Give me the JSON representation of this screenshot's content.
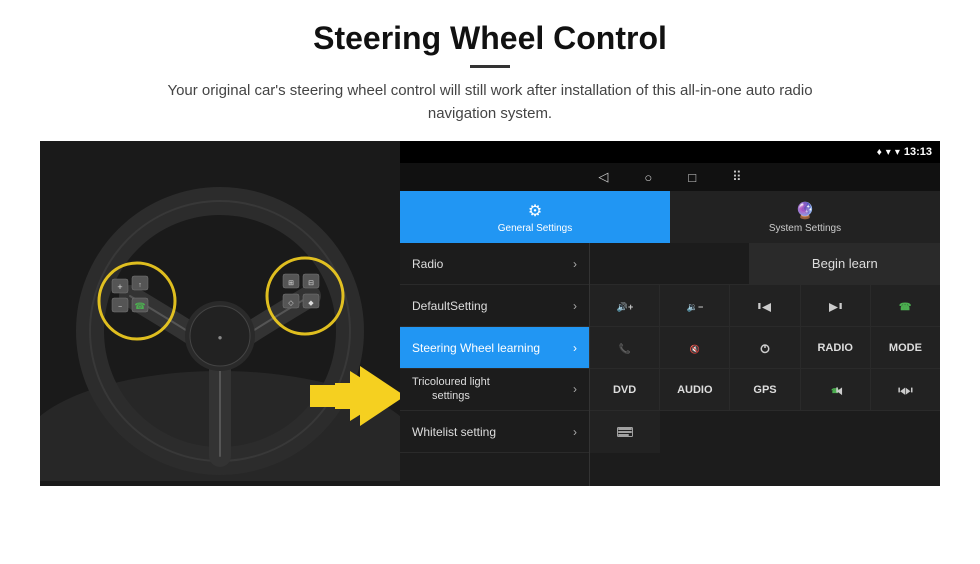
{
  "header": {
    "title": "Steering Wheel Control",
    "divider": true,
    "subtitle": "Your original car's steering wheel control will still work after installation of this all-in-one auto radio navigation system."
  },
  "status_bar": {
    "location_icon": "♦",
    "wifi_icon": "▾",
    "signal_icon": "▾",
    "time": "13:13"
  },
  "nav_bar": {
    "back": "◁",
    "home": "○",
    "recent": "□",
    "menu": "⠿"
  },
  "tabs": [
    {
      "id": "general",
      "label": "General Settings",
      "active": true
    },
    {
      "id": "system",
      "label": "System Settings",
      "active": false
    }
  ],
  "menu_items": [
    {
      "id": "radio",
      "label": "Radio",
      "active": false
    },
    {
      "id": "default",
      "label": "DefaultSetting",
      "active": false
    },
    {
      "id": "steering",
      "label": "Steering Wheel learning",
      "active": true
    },
    {
      "id": "tricoloured",
      "label": "Tricoloured light settings",
      "active": false
    },
    {
      "id": "whitelist",
      "label": "Whitelist setting",
      "active": false
    }
  ],
  "controls": {
    "begin_learn": "Begin learn",
    "row1": [
      "vol+",
      "vol-",
      "prev-track",
      "next-track",
      "phone"
    ],
    "row2": [
      "answer",
      "mute",
      "power",
      "RADIO",
      "MODE"
    ],
    "row3": [
      "DVD",
      "AUDIO",
      "GPS",
      "phone-prev",
      "skip-prev-next"
    ],
    "row4": [
      "list-icon"
    ]
  }
}
